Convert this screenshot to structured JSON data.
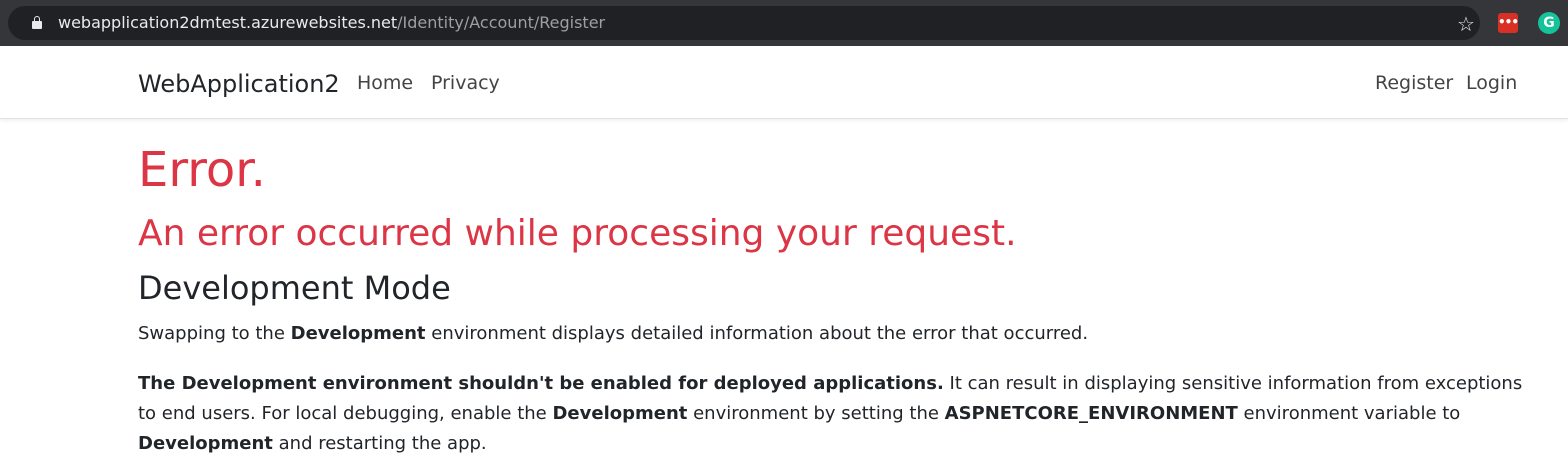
{
  "browser": {
    "url_host": "webapplication2dmtest.azurewebsites.net",
    "url_path": "/Identity/Account/Register",
    "bookmark_icon": "star-icon",
    "extensions": [
      {
        "icon": "lastpass-icon",
        "glyph": "•••"
      },
      {
        "icon": "grammarly-icon",
        "glyph": "G"
      }
    ]
  },
  "navbar": {
    "brand": "WebApplication2",
    "home": "Home",
    "privacy": "Privacy",
    "register": "Register",
    "login": "Login"
  },
  "main": {
    "title": "Error.",
    "subtitle": "An error occurred while processing your request.",
    "dev_heading": "Development Mode",
    "p1": {
      "before": "Swapping to the ",
      "bold": "Development",
      "after": " environment displays detailed information about the error that occurred."
    },
    "p2": {
      "bold1": "The Development environment shouldn't be enabled for deployed applications.",
      "text1": " It can result in displaying sensitive information from exceptions to end users. For local debugging, enable the ",
      "bold2": "Development",
      "text2": " environment by setting the ",
      "bold3": "ASPNETCORE_ENVIRONMENT",
      "text3": " environment variable to ",
      "bold4": "Development",
      "text4": " and restarting the app."
    }
  },
  "colors": {
    "error": "#dc3545",
    "text": "#212529",
    "chrome": "#35363a"
  }
}
